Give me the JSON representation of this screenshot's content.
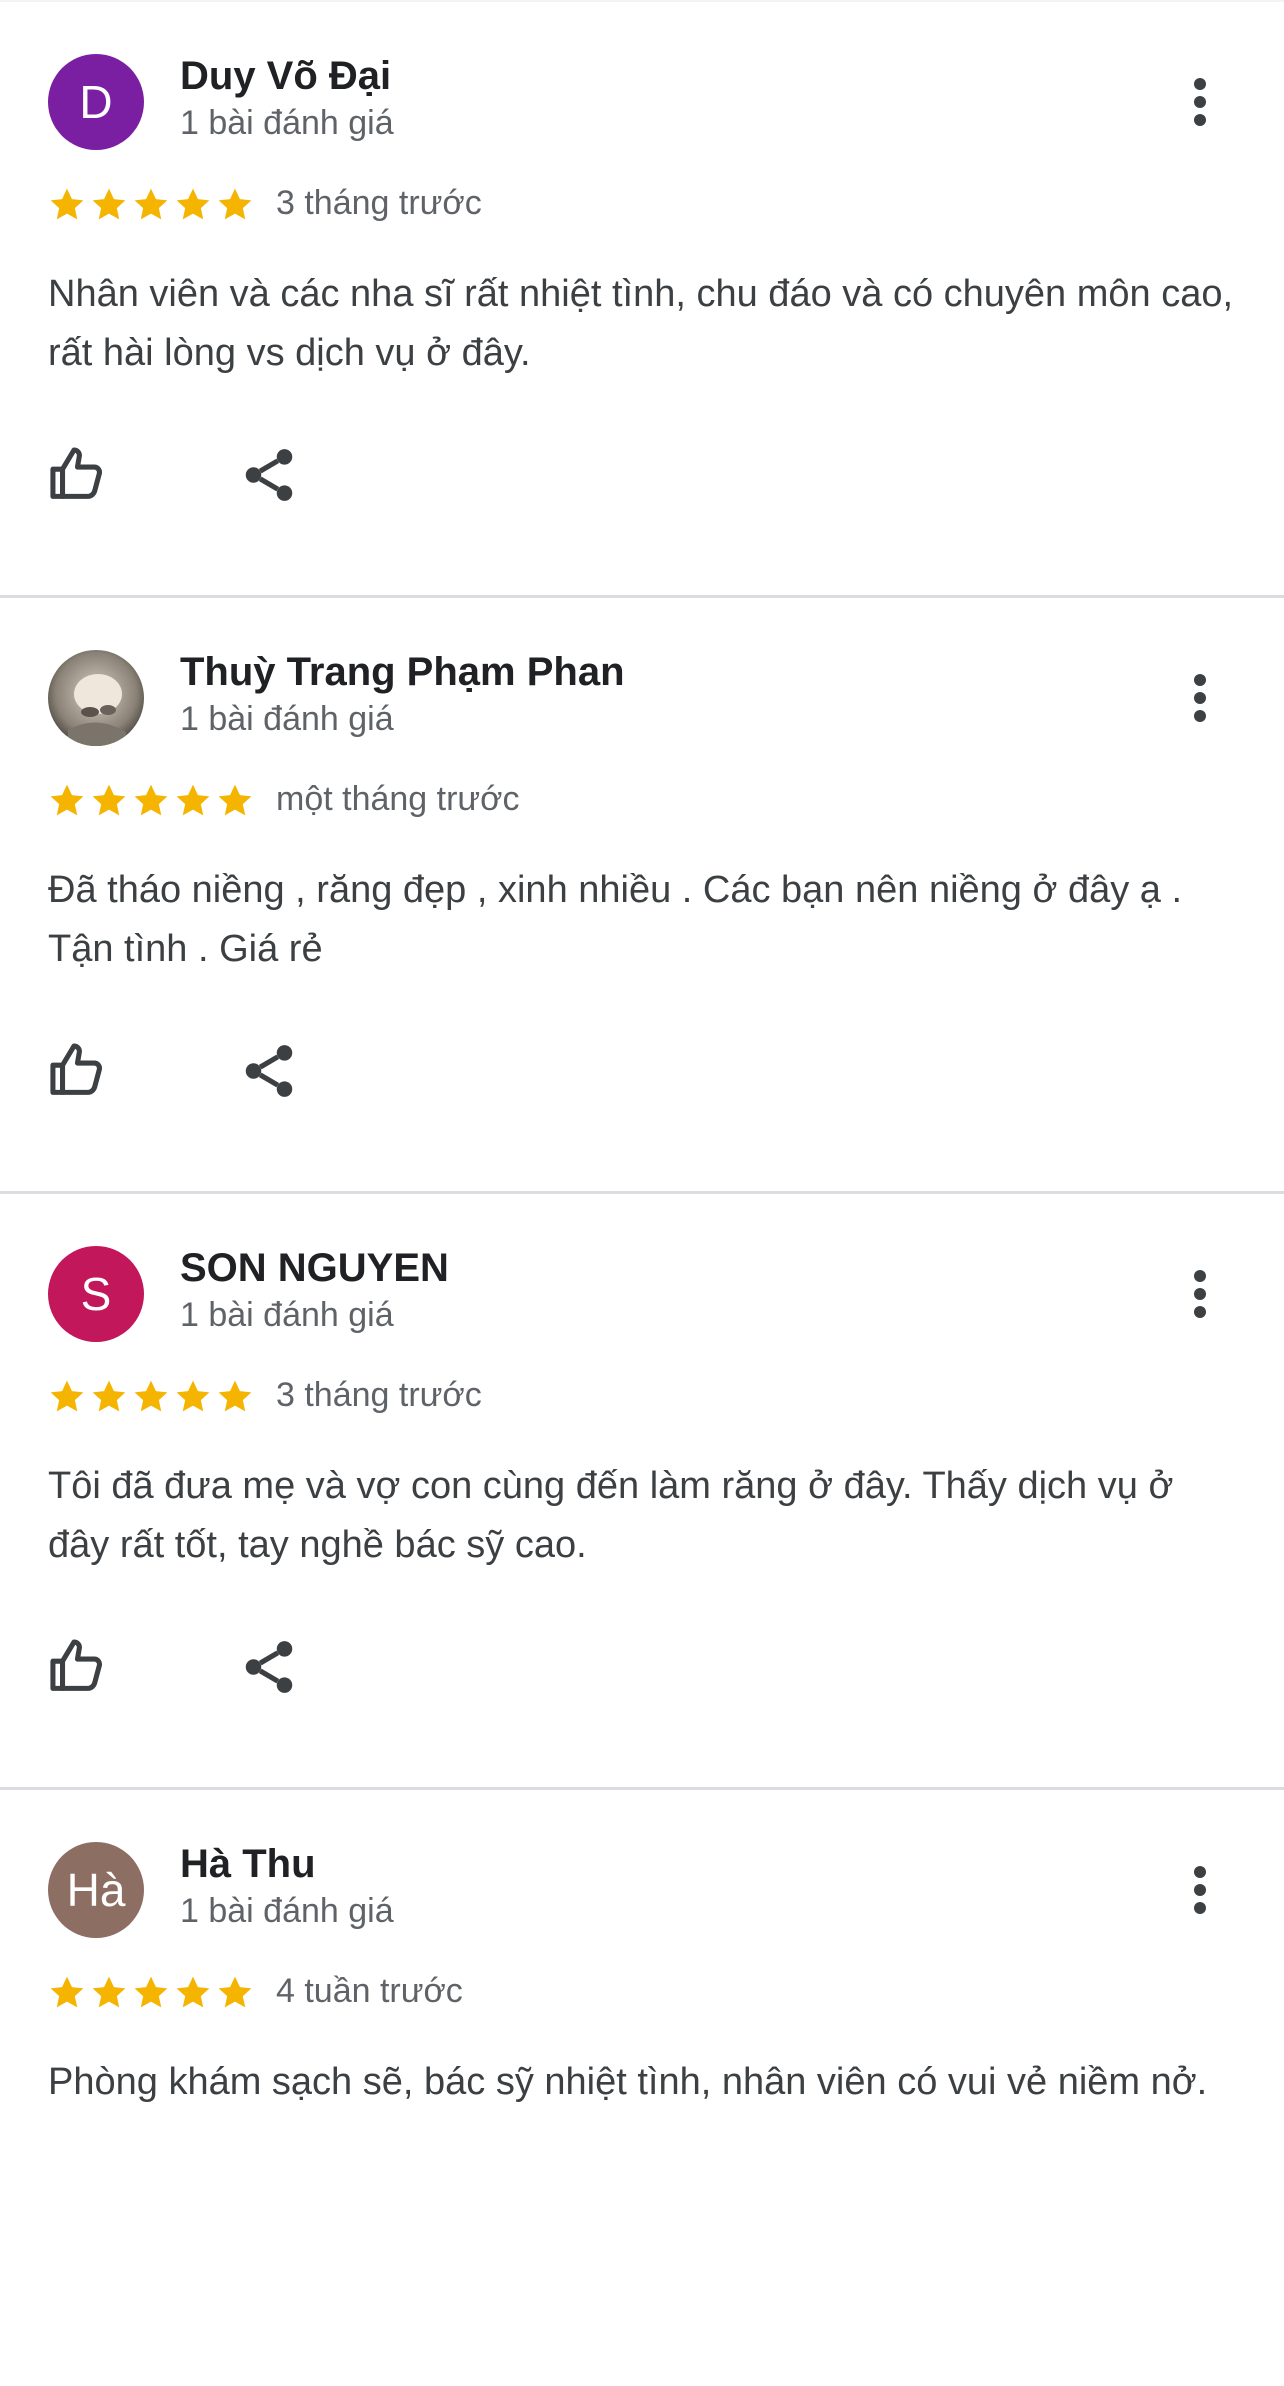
{
  "colors": {
    "star": "#f4b400",
    "avatar_d": "#7b1fa2",
    "avatar_s": "#c2185b",
    "avatar_ha": "#8d6e63",
    "divider": "#dadce0"
  },
  "reviews": [
    {
      "avatar_letter": "D",
      "avatar_type": "letter",
      "name": "Duy Võ Đại",
      "review_count": "1 bài đánh giá",
      "rating": 5,
      "date": "3 tháng trước",
      "text": "Nhân viên và các nha sĩ rất nhiệt tình, chu đáo và có chuyên môn cao, rất hài lòng vs dịch vụ ở đây."
    },
    {
      "avatar_letter": "",
      "avatar_type": "photo",
      "name": "Thuỳ Trang Phạm Phan",
      "review_count": "1 bài đánh giá",
      "rating": 5,
      "date": "một tháng trước",
      "text": "Đã tháo niềng , răng đẹp , xinh nhiều . Các bạn nên niềng ở đây ạ . Tận tình . Giá rẻ"
    },
    {
      "avatar_letter": "S",
      "avatar_type": "letter",
      "name": "SON NGUYEN",
      "review_count": "1 bài đánh giá",
      "rating": 5,
      "date": "3 tháng trước",
      "text": "Tôi đã đưa mẹ và vợ con cùng đến làm răng ở đây. Thấy dịch vụ ở đây rất tốt, tay nghề bác sỹ cao."
    },
    {
      "avatar_letter": "Hà",
      "avatar_type": "letter",
      "name": "Hà Thu",
      "review_count": "1 bài đánh giá",
      "rating": 5,
      "date": "4 tuần trước",
      "text": "Phòng khám sạch sẽ, bác sỹ nhiệt tình, nhân viên có vui vẻ niềm nở."
    }
  ]
}
